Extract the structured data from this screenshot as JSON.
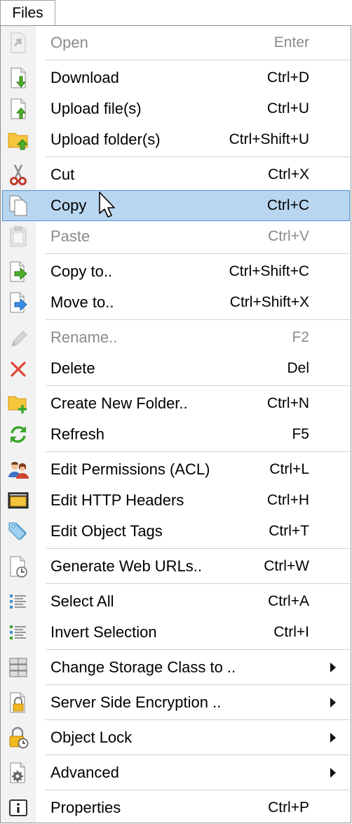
{
  "menubar": {
    "title": "Files"
  },
  "menu": {
    "items": [
      {
        "label": "Open",
        "shortcut": "Enter",
        "icon": "open-icon",
        "disabled": true
      },
      {
        "label": "Download",
        "shortcut": "Ctrl+D",
        "icon": "download-icon"
      },
      {
        "label": "Upload file(s)",
        "shortcut": "Ctrl+U",
        "icon": "upload-file-icon"
      },
      {
        "label": "Upload folder(s)",
        "shortcut": "Ctrl+Shift+U",
        "icon": "upload-folder-icon"
      },
      {
        "label": "Cut",
        "shortcut": "Ctrl+X",
        "icon": "scissors-icon"
      },
      {
        "label": "Copy",
        "shortcut": "Ctrl+C",
        "icon": "copy-icon",
        "highlighted": true
      },
      {
        "label": "Paste",
        "shortcut": "Ctrl+V",
        "icon": "paste-icon",
        "disabled": true
      },
      {
        "label": "Copy to..",
        "shortcut": "Ctrl+Shift+C",
        "icon": "copy-to-icon"
      },
      {
        "label": "Move to..",
        "shortcut": "Ctrl+Shift+X",
        "icon": "move-to-icon"
      },
      {
        "label": "Rename..",
        "shortcut": "F2",
        "icon": "pencil-icon",
        "disabled": true
      },
      {
        "label": "Delete",
        "shortcut": "Del",
        "icon": "delete-icon"
      },
      {
        "label": "Create New Folder..",
        "shortcut": "Ctrl+N",
        "icon": "new-folder-icon"
      },
      {
        "label": "Refresh",
        "shortcut": "F5",
        "icon": "refresh-icon"
      },
      {
        "label": "Edit Permissions (ACL)",
        "shortcut": "Ctrl+L",
        "icon": "users-icon"
      },
      {
        "label": "Edit HTTP Headers",
        "shortcut": "Ctrl+H",
        "icon": "window-icon"
      },
      {
        "label": "Edit Object Tags",
        "shortcut": "Ctrl+T",
        "icon": "tags-icon"
      },
      {
        "label": "Generate Web URLs..",
        "shortcut": "Ctrl+W",
        "icon": "clock-file-icon"
      },
      {
        "label": "Select All",
        "shortcut": "Ctrl+A",
        "icon": "list-icon"
      },
      {
        "label": "Invert Selection",
        "shortcut": "Ctrl+I",
        "icon": "list-invert-icon"
      },
      {
        "label": "Change Storage Class to ..",
        "shortcut": "",
        "icon": "storage-icon",
        "submenu": true
      },
      {
        "label": "Server Side Encryption ..",
        "shortcut": "",
        "icon": "lock-file-icon",
        "submenu": true
      },
      {
        "label": "Object Lock",
        "shortcut": "",
        "icon": "padlock-clock-icon",
        "submenu": true
      },
      {
        "label": "Advanced",
        "shortcut": "",
        "icon": "gear-file-icon",
        "submenu": true
      },
      {
        "label": "Properties",
        "shortcut": "Ctrl+P",
        "icon": "info-icon"
      }
    ]
  }
}
